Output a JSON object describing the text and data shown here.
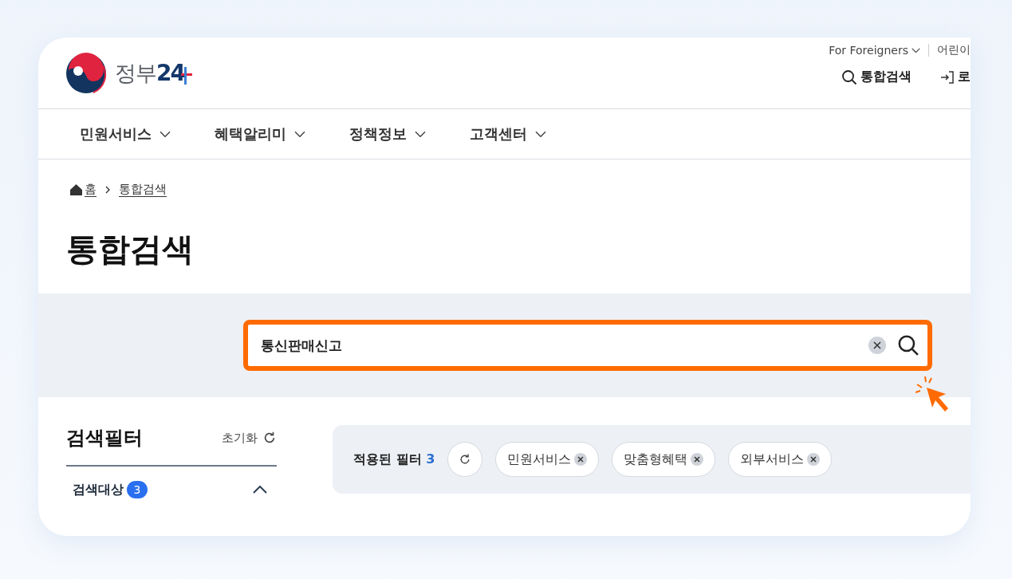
{
  "header": {
    "logo_name": "정부",
    "logo_number": "24",
    "utility_links": [
      "For Foreigners",
      "어린이"
    ],
    "actions": [
      {
        "kind": "search",
        "label": "통합검색"
      },
      {
        "kind": "login",
        "label": "로"
      }
    ]
  },
  "nav": [
    "민원서비스",
    "혜택알리미",
    "정책정보",
    "고객센터"
  ],
  "breadcrumb": [
    "홈",
    "통합검색"
  ],
  "page_title": "통합검색",
  "search": {
    "value": "통신판매신고"
  },
  "filter": {
    "title": "검색필터",
    "reset": "초기화",
    "section": {
      "label": "검색대상",
      "count": "3",
      "expanded": true
    }
  },
  "applied": {
    "label": "적용된 필터",
    "count": "3",
    "chips": [
      "민원서비스",
      "맞춤형혜택",
      "외부서비스"
    ]
  }
}
